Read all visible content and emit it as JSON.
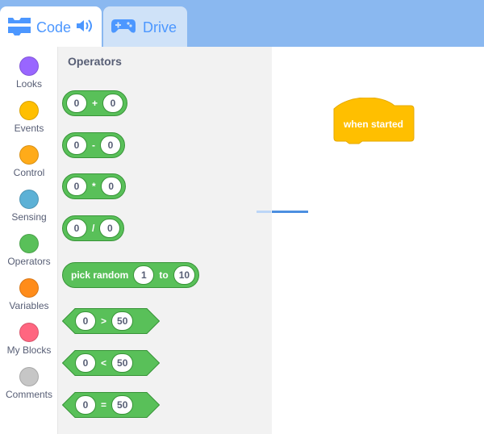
{
  "tabs": [
    {
      "label": "Code",
      "active": true
    },
    {
      "label": "Drive",
      "active": false
    }
  ],
  "categories": [
    {
      "label": "Looks",
      "color": "#9966ff"
    },
    {
      "label": "Events",
      "color": "#ffbf00"
    },
    {
      "label": "Control",
      "color": "#ffab19"
    },
    {
      "label": "Sensing",
      "color": "#5cb1d6"
    },
    {
      "label": "Operators",
      "color": "#59c059"
    },
    {
      "label": "Variables",
      "color": "#ff8c1a"
    },
    {
      "label": "My Blocks",
      "color": "#ff6680"
    },
    {
      "label": "Comments",
      "color": "#c6c6c6"
    }
  ],
  "flyout": {
    "title": "Operators",
    "add": {
      "a": "0",
      "op": "+",
      "b": "0"
    },
    "subtract": {
      "a": "0",
      "op": "-",
      "b": "0"
    },
    "multiply": {
      "a": "0",
      "op": "*",
      "b": "0"
    },
    "divide": {
      "a": "0",
      "op": "/",
      "b": "0"
    },
    "random": {
      "label": "pick random",
      "from": "1",
      "to_label": "to",
      "to": "10"
    },
    "gt": {
      "a": "0",
      "op": ">",
      "b": "50"
    },
    "lt": {
      "a": "0",
      "op": "<",
      "b": "50"
    },
    "eq": {
      "a": "0",
      "op": "=",
      "b": "50"
    }
  },
  "workspace": {
    "hat_label": "when started"
  },
  "colors": {
    "operators": "#59c059",
    "events": "#ffbf00",
    "accent": "#4c97ff"
  }
}
